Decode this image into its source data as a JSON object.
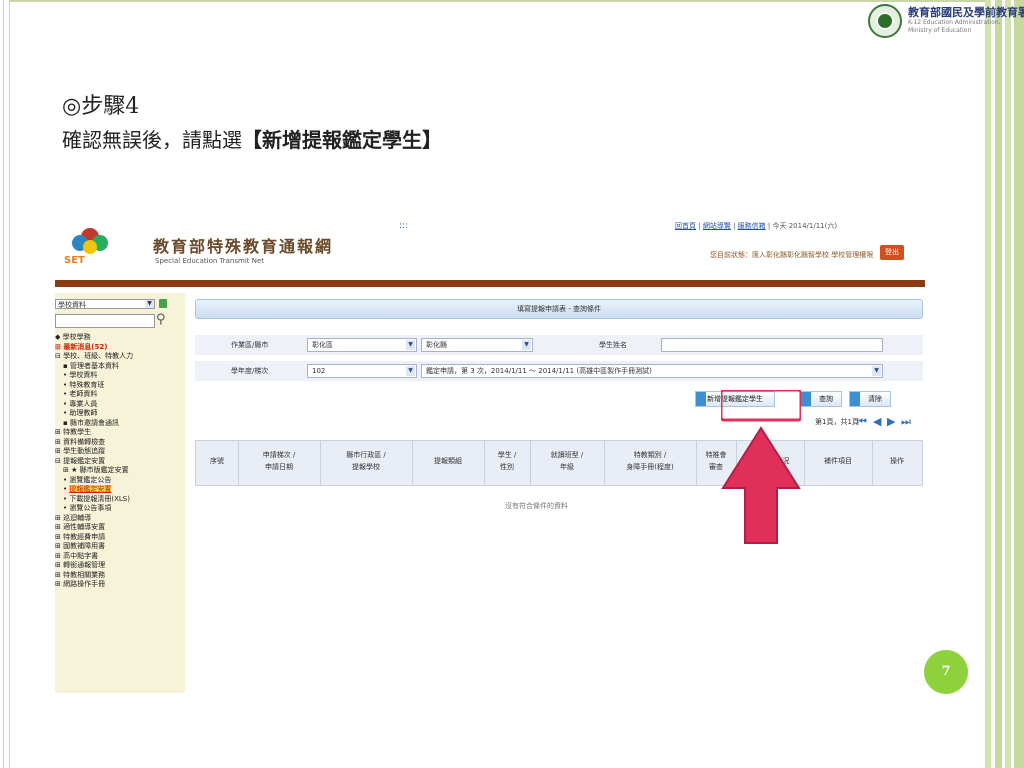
{
  "header": {
    "moe_title": "教育部國民及學前教育署",
    "moe_sub_line1": "K-12 Education Administration,",
    "moe_sub_line2": "Ministry of Education"
  },
  "slide": {
    "step_title": "◎步驟4",
    "step_desc_prefix": "確認無誤後，請點選",
    "step_desc_highlight": "【新增提報鑑定學生】",
    "page_number": "7"
  },
  "app": {
    "title": "教育部特殊教育通報網",
    "subtitle": "Special Education Transmit Net",
    "dots": ":::",
    "links": {
      "home": "回首頁",
      "sitemap": "網站導覽",
      "mailbox": "服務信箱",
      "date": "今天 2014/1/11(六)",
      "sep": "|"
    },
    "status": "您目前狀態：匯入彰化縣彰化縣智學校 學校管理權限",
    "logout": "登出"
  },
  "sidebar": {
    "select_value": "學校資料",
    "items": [
      "學校學務",
      "最新消息(52)",
      "學校、班級、特教人力",
      "管理者基本資料",
      "學校資料",
      "特殊教育班",
      "老師資料",
      "專業人員",
      "助理教師",
      "縣市邀請會通訊",
      "特教學生",
      "資料備轉檢查",
      "學生動態追蹤",
      "提報鑑定安置",
      "縣市版鑑定安置",
      "瀏覽鑑定公告",
      "提報鑑定安置",
      "下載提報清冊(XLS)",
      "瀏覽公告事項",
      "巡迴輔導",
      "適性輔導安置",
      "特教經費申請",
      "國教補障用書",
      "高中點字書",
      "轉銜通報管理",
      "特教相關業務",
      "網路操作手冊"
    ]
  },
  "main": {
    "query_title": "填寫提報申請表 - 查詢條件",
    "row1": {
      "label_area": "作業區/縣市",
      "area_value": "彰化區",
      "county_value": "彰化縣",
      "label_name": "學生姓名",
      "name_value": ""
    },
    "row2": {
      "label_year": "學年度/梯次",
      "year_value": "102",
      "batch_value": "鑑定申請，第 3 次，2014/1/11 ～ 2014/1/11 (高雄中區製作手冊測試)"
    },
    "buttons": {
      "add": "新增提報鑑定學生",
      "query": "查詢",
      "clear": "清除"
    },
    "pager": "第1頁，共1頁",
    "columns": [
      [
        "序號"
      ],
      [
        "申請梯次 /",
        "申請日期"
      ],
      [
        "縣市行政區 /",
        "提報學校"
      ],
      [
        "提報類組"
      ],
      [
        "學生 /",
        "性別"
      ],
      [
        "就讀班型 /",
        "年級"
      ],
      [
        "特教類別 /",
        "身障手冊(程度)"
      ],
      [
        "特推會",
        "審查"
      ],
      [
        "件狀況"
      ],
      [
        "補件項目"
      ],
      [
        "操作"
      ]
    ],
    "no_data": "沒有符合條件的資料"
  },
  "colors": {
    "accent": "#8fd13a",
    "brand_bar": "#8b3a14",
    "arrow": "#e0305a"
  }
}
